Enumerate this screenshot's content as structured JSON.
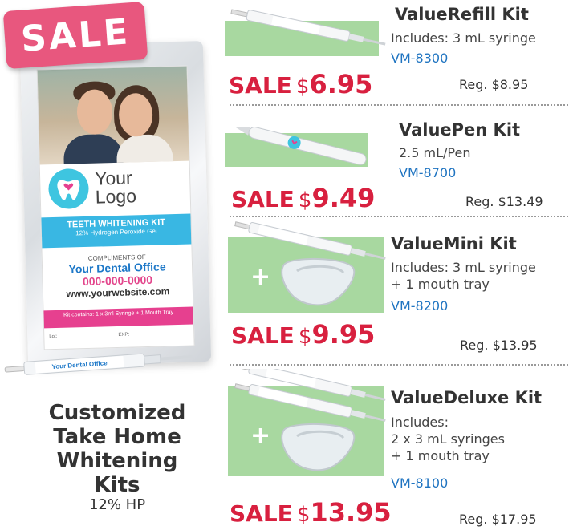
{
  "promo": {
    "badge": "SALE",
    "pouch": {
      "logo_line1": "Your",
      "logo_line2": "Logo",
      "kit_title": "TEETH WHITENING KIT",
      "kit_subtitle": "12% Hydrogen Peroxide Gel",
      "compliments": "COMPLIMENTS OF",
      "office": "Your Dental Office",
      "phone": "000-000-0000",
      "website": "www.yourwebsite.com",
      "contains": "Kit contains: 1 x 3ml Syringe + 1 Mouth Tray",
      "lot": "Lot:",
      "exp": "EXP:"
    },
    "syringe_text": "Your Dental Office",
    "title_line1": "Customized",
    "title_line2": "Take Home",
    "title_line3": "Whitening Kits",
    "subtitle": "12% HP"
  },
  "products": [
    {
      "name": "ValueRefill Kit",
      "desc_lines": [
        "Includes: 3 mL syringe"
      ],
      "sku": "VM-8300",
      "sale_word": "SALE",
      "sale_currency": "$",
      "sale_amount": "6.95",
      "regular": "Reg. $8.95"
    },
    {
      "name": "ValuePen Kit",
      "desc_lines": [
        "2.5 mL/Pen"
      ],
      "sku": "VM-8700",
      "sale_word": "SALE",
      "sale_currency": "$",
      "sale_amount": "9.49",
      "regular": "Reg. $13.49"
    },
    {
      "name": "ValueMini Kit",
      "desc_lines": [
        "Includes: 3 mL syringe",
        "+ 1 mouth tray"
      ],
      "sku": "VM-8200",
      "sale_word": "SALE",
      "sale_currency": "$",
      "sale_amount": "9.95",
      "regular": "Reg. $13.95"
    },
    {
      "name": "ValueDeluxe Kit",
      "desc_lines": [
        "Includes:",
        "2 x 3 mL syringes",
        "+ 1 mouth tray"
      ],
      "sku": "VM-8100",
      "sale_word": "SALE",
      "sale_currency": "$",
      "sale_amount": "13.95",
      "regular": "Reg. $17.95"
    }
  ],
  "thumb_plus": "+",
  "colors": {
    "sale_red": "#d8203f",
    "sku_blue": "#1f74c1",
    "badge_pink": "#e8577e",
    "thumb_green": "#a8d8a0"
  }
}
